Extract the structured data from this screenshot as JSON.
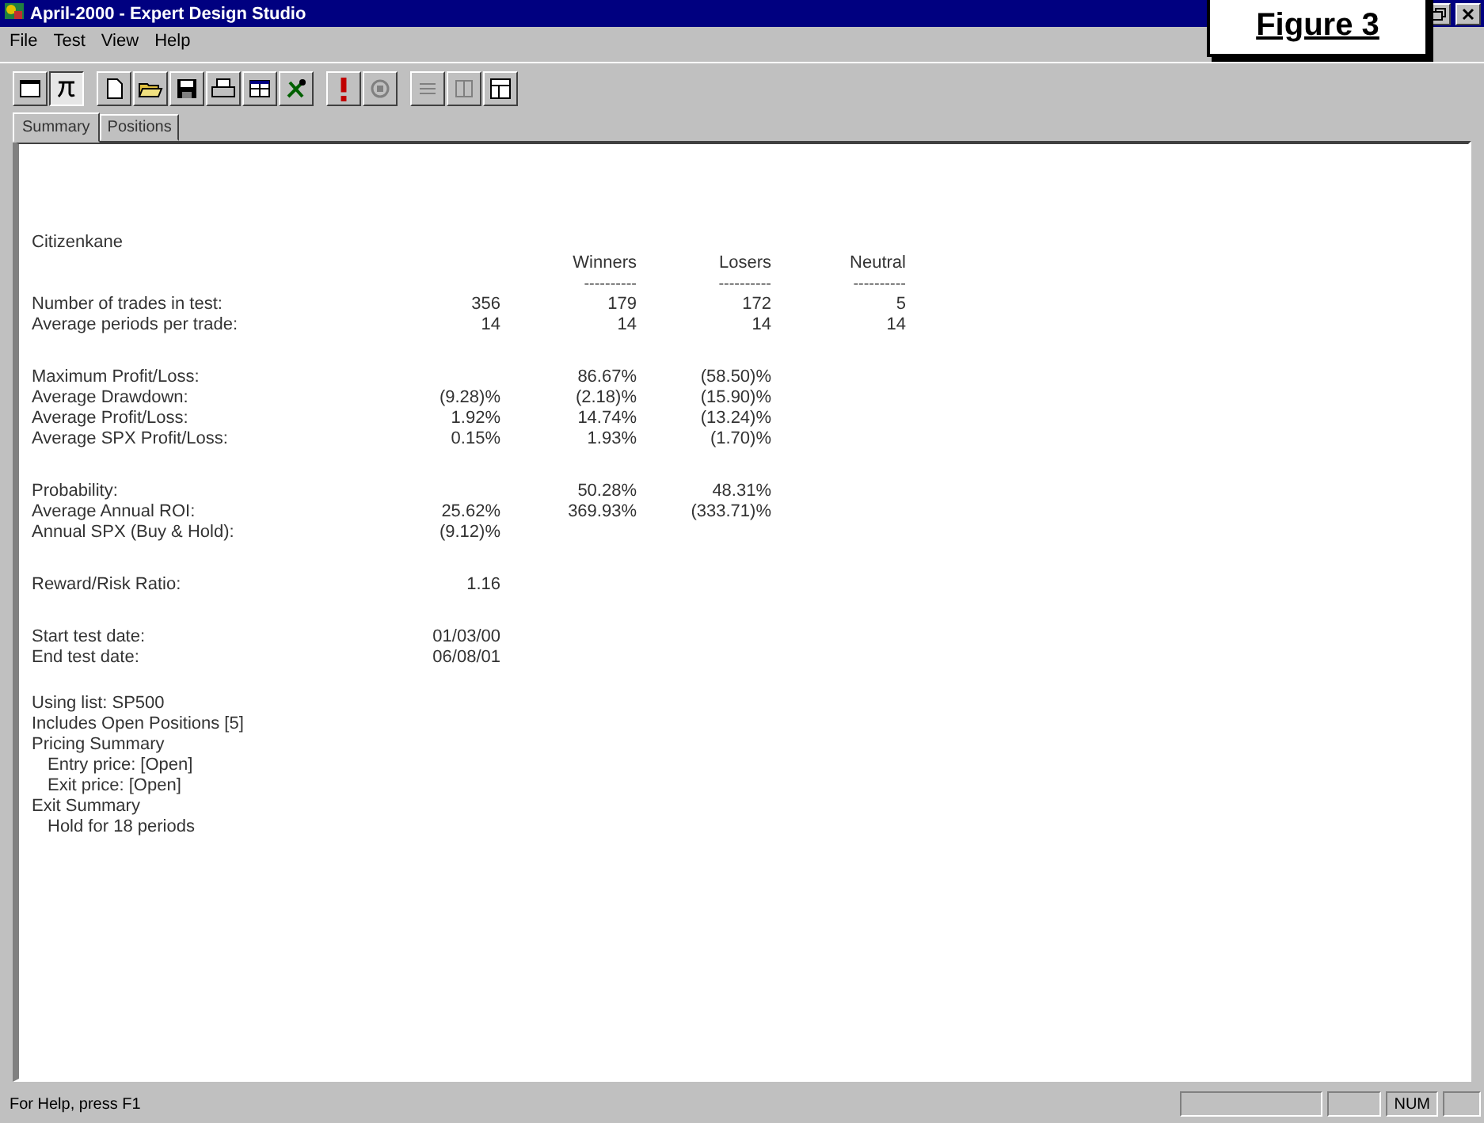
{
  "window": {
    "title": "April-2000 - Expert Design Studio"
  },
  "figure_label": "Figure 3",
  "menu": [
    "File",
    "Test",
    "View",
    "Help"
  ],
  "toolbar": [
    [
      {
        "kind": "window",
        "pressed": false
      },
      {
        "kind": "formula",
        "pressed": true
      }
    ],
    [
      {
        "kind": "new",
        "pressed": false
      },
      {
        "kind": "open",
        "pressed": false
      },
      {
        "kind": "save",
        "pressed": false
      },
      {
        "kind": "print",
        "pressed": false
      },
      {
        "kind": "panes",
        "pressed": false
      },
      {
        "kind": "tools",
        "pressed": false
      }
    ],
    [
      {
        "kind": "alert",
        "pressed": false
      },
      {
        "kind": "stop",
        "pressed": false
      }
    ],
    [
      {
        "kind": "list",
        "pressed": false
      },
      {
        "kind": "grid",
        "pressed": false
      },
      {
        "kind": "layout",
        "pressed": false
      }
    ]
  ],
  "tabs": [
    {
      "label": "Summary",
      "selected": true
    },
    {
      "label": "Positions",
      "selected": false
    }
  ],
  "report": {
    "name": "Citizenkane",
    "columns": [
      {
        "heading": "Winners",
        "rule": "----------"
      },
      {
        "heading": "Losers",
        "rule": "----------"
      },
      {
        "heading": "Neutral",
        "rule": "----------"
      }
    ],
    "groups": [
      {
        "rows": [
          {
            "label": "Number of trades in test:",
            "column_1": "356",
            "winners": "179",
            "losers": "172",
            "neutral": "5"
          },
          {
            "label": "Average periods per trade:",
            "column_1": "14",
            "winners": "14",
            "losers": "14",
            "neutral": "14"
          }
        ]
      },
      {
        "rows": [
          {
            "label": "Maximum Profit/Loss:",
            "winners": "86.67%",
            "losers": "(58.50)%"
          },
          {
            "label": "Average Drawdown:",
            "column_1": "(9.28)%",
            "winners": "(2.18)%",
            "losers": "(15.90)%"
          },
          {
            "label": "Average Profit/Loss:",
            "column_1": "1.92%",
            "winners": "14.74%",
            "losers": "(13.24)%"
          },
          {
            "label": "Average SPX Profit/Loss:",
            "column_1": "0.15%",
            "winners": "1.93%",
            "losers": "(1.70)%"
          }
        ]
      },
      {
        "rows": [
          {
            "label": "Probability:",
            "winners": "50.28%",
            "losers": "48.31%"
          },
          {
            "label": "Average Annual ROI:",
            "column_1": "25.62%",
            "winners": "369.93%",
            "losers": "(333.71)%"
          },
          {
            "label": "Annual SPX (Buy & Hold):",
            "column_1": "(9.12)%"
          }
        ]
      },
      {
        "rows": [
          {
            "label": "Reward/Risk Ratio:",
            "column_1": "1.16"
          }
        ]
      },
      {
        "rows": [
          {
            "label": "Start test date:",
            "column_1": "01/03/00"
          },
          {
            "label": "End test date:",
            "column_1": "06/08/01"
          }
        ]
      }
    ],
    "notes": [
      {
        "text": "Using list: SP500"
      },
      {
        "text": "Includes Open Positions [5]"
      },
      {
        "text": "Pricing Summary",
        "children": [
          {
            "text": "Entry price: [Open]"
          },
          {
            "text": "Exit price: [Open]"
          }
        ]
      },
      {
        "text": "Exit Summary",
        "children": [
          {
            "text": "Hold for 18 periods"
          }
        ]
      }
    ]
  },
  "status_bar": {
    "message": "For Help, press F1",
    "indicator": "NUM"
  }
}
